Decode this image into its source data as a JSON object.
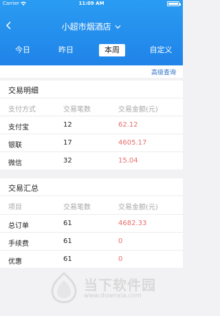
{
  "status_bar": {
    "carrier": "Carrier",
    "time": "11:09 AM"
  },
  "nav": {
    "title": "小超市烟酒店"
  },
  "tabs": [
    {
      "label": "今日",
      "active": false
    },
    {
      "label": "昨日",
      "active": false
    },
    {
      "label": "本周",
      "active": true
    },
    {
      "label": "自定义",
      "active": false
    }
  ],
  "advanced_query": "高级查询",
  "details": {
    "title": "交易明细",
    "headers": [
      "支付方式",
      "交易笔数",
      "交易金额(元)"
    ],
    "rows": [
      {
        "method": "支付宝",
        "count": "12",
        "amount": "62.12"
      },
      {
        "method": "银联",
        "count": "17",
        "amount": "4605.17"
      },
      {
        "method": "微信",
        "count": "32",
        "amount": "15.04"
      }
    ]
  },
  "summary": {
    "title": "交易汇总",
    "headers": [
      "项目",
      "交易笔数",
      "交易金额(元)"
    ],
    "rows": [
      {
        "item": "总订单",
        "count": "61",
        "amount": "4682.33"
      },
      {
        "item": "手续费",
        "count": "61",
        "amount": "0"
      },
      {
        "item": "优惠",
        "count": "61",
        "amount": "0"
      }
    ]
  },
  "watermark": {
    "text": "当下软件园",
    "url": "www.downxia.com"
  },
  "colors": {
    "header": "#1f83e8",
    "amount": "#e86d6d",
    "link": "#2a6fc9"
  }
}
